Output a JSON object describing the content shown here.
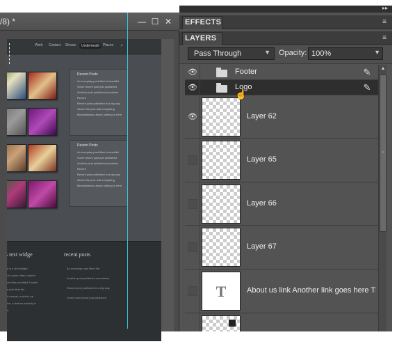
{
  "doc": {
    "title": "/8) *",
    "controls": {
      "minimize": "—",
      "maximize": "☐",
      "close": "✕"
    },
    "site": {
      "nav": [
        "Work",
        "Contact",
        "Shows",
        "Underneath",
        "Places"
      ],
      "recent_boxes": [
        {
          "title": "Recent Posts",
          "lines": [
            "An everyday post titled a beautiful",
            "Some recent post just published",
            "Another post published sometime",
            "Recent",
            "Recent post published in a big way",
            "About this post and everything",
            "Miscellaneous about nothing in here"
          ]
        },
        {
          "title": "Recent Posts",
          "lines": [
            "An everyday post titled a beautiful",
            "Some recent post just published",
            "Another post published sometime",
            "Recent",
            "Recent post published in a big way",
            "About this post and everything",
            "Miscellaneous about nothing in here"
          ]
        }
      ],
      "footer": {
        "left_heading": "s text widge",
        "right_heading": "recent posts",
        "left_lines": [
          "s is a text widget.",
          "l to some other content",
          "ws Was modified Trouble",
          "e plan that the",
          "t a sweet, a whole cal",
          "ive, a feature sweetly in",
          "d."
        ],
        "right_lines": [
          "An everyday post titled the",
          "Another post published sometimes",
          "Recent post published in a big way",
          "Some recent post just published"
        ]
      }
    }
  },
  "panels": {
    "effects_label": "EFFECTS",
    "layers_label": "LAYERS",
    "blend_mode": "Pass Through",
    "opacity_label": "Opacity:",
    "opacity_value": "100%",
    "layers": [
      {
        "name": "Footer",
        "kind": "group",
        "visible": true,
        "selected": false
      },
      {
        "name": "Logo",
        "kind": "group",
        "visible": true,
        "selected": true
      },
      {
        "name": "Layer 62",
        "kind": "raster",
        "visible": true,
        "selected": false
      },
      {
        "name": "Layer 65",
        "kind": "raster",
        "visible": false,
        "selected": false
      },
      {
        "name": "Layer 66",
        "kind": "raster",
        "visible": false,
        "selected": false
      },
      {
        "name": "Layer 67",
        "kind": "raster",
        "visible": false,
        "selected": false
      },
      {
        "name": "About us link Another link goes here Thi...",
        "kind": "text",
        "thumb_glyph": "T",
        "visible": false,
        "selected": false
      },
      {
        "name": "",
        "kind": "raster",
        "visible": false,
        "selected": false
      }
    ]
  },
  "icons": {
    "eye": "eye-icon",
    "folder": "folder-icon",
    "brush": "brush-icon",
    "cursor": "hand-cursor-icon",
    "panel_menu": "panel-menu-icon",
    "collapse": "collapse-panels-icon"
  },
  "colors": {
    "panel_bg": "#535353",
    "selected_row": "#2e2e2e",
    "guide": "#39c6d9"
  }
}
